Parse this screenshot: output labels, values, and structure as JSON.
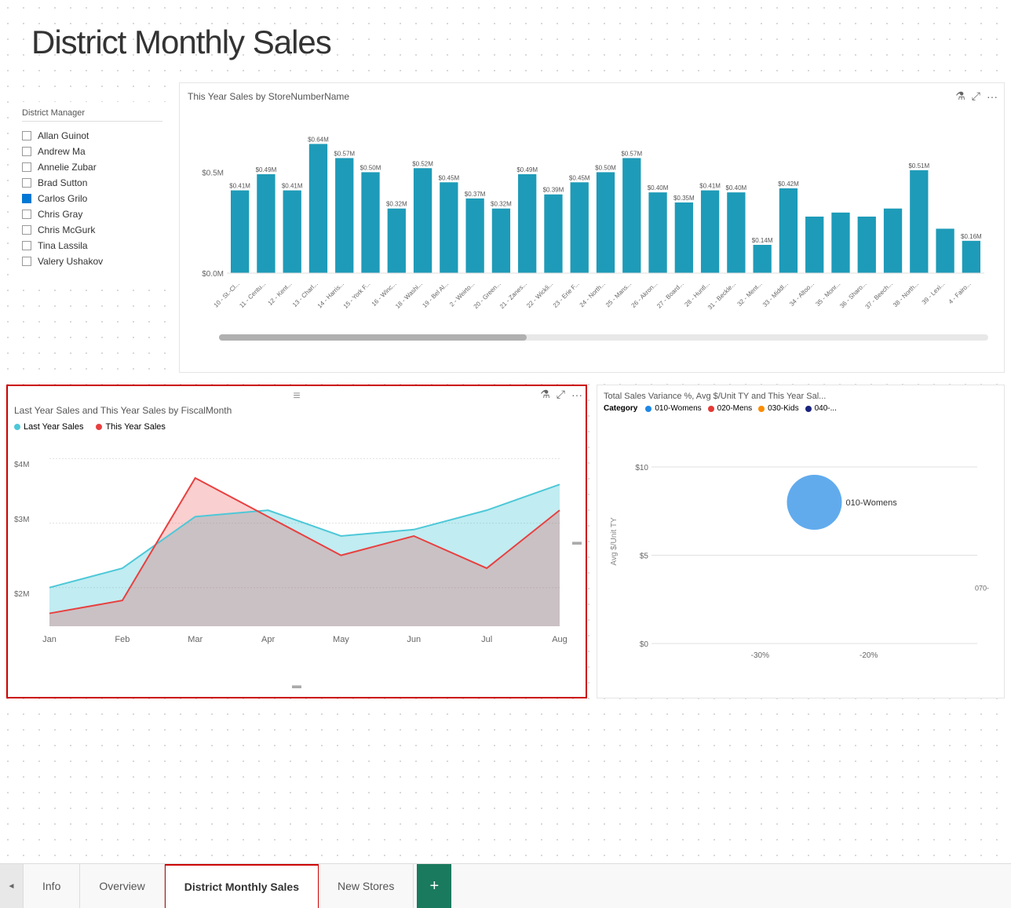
{
  "page": {
    "title": "District Monthly Sales",
    "background": "dotted"
  },
  "district_manager": {
    "label": "District Manager",
    "managers": [
      {
        "name": "Allan Guinot",
        "checked": false
      },
      {
        "name": "Andrew Ma",
        "checked": false
      },
      {
        "name": "Annelie Zubar",
        "checked": false
      },
      {
        "name": "Brad Sutton",
        "checked": false
      },
      {
        "name": "Carlos Grilo",
        "checked": true
      },
      {
        "name": "Chris Gray",
        "checked": false
      },
      {
        "name": "Chris McGurk",
        "checked": false
      },
      {
        "name": "Tina Lassila",
        "checked": false
      },
      {
        "name": "Valery Ushakov",
        "checked": false
      }
    ]
  },
  "bar_chart": {
    "title": "This Year Sales by StoreNumberName",
    "y_min": "$0.0M",
    "y_max": "$0.5M",
    "bars": [
      {
        "label": "10 - St.-Cl...",
        "value": 0.41,
        "display": "$0.41M"
      },
      {
        "label": "11 - Centu...",
        "value": 0.49,
        "display": "$0.49M"
      },
      {
        "label": "12 - Kent...",
        "value": 0.41,
        "display": "$0.41M"
      },
      {
        "label": "13 - Charl...",
        "value": 0.64,
        "display": "$0.64M"
      },
      {
        "label": "14 - Harris...",
        "value": 0.57,
        "display": "$0.57M"
      },
      {
        "label": "15 - York F...",
        "value": 0.5,
        "display": "$0.50M"
      },
      {
        "label": "16 - Winc...",
        "value": 0.32,
        "display": "$0.32M"
      },
      {
        "label": "18 - Washi...",
        "value": 0.52,
        "display": "$0.52M"
      },
      {
        "label": "19 - Bel Al...",
        "value": 0.45,
        "display": "$0.45M"
      },
      {
        "label": "2 - Weirto...",
        "value": 0.37,
        "display": "$0.37M"
      },
      {
        "label": "20 - Green...",
        "value": 0.32,
        "display": "$0.32M"
      },
      {
        "label": "21 - Zanes...",
        "value": 0.49,
        "display": "$0.49M"
      },
      {
        "label": "22 - Wickli...",
        "value": 0.39,
        "display": "$0.39M"
      },
      {
        "label": "23 - Erie F...",
        "value": 0.45,
        "display": "$0.45M"
      },
      {
        "label": "24 - North...",
        "value": 0.5,
        "display": "$0.50M"
      },
      {
        "label": "25 - Mans...",
        "value": 0.57,
        "display": "$0.57M"
      },
      {
        "label": "26 - Akron...",
        "value": 0.4,
        "display": "$0.40M"
      },
      {
        "label": "27 - Board...",
        "value": 0.35,
        "display": "$0.35M"
      },
      {
        "label": "28 - Huntl...",
        "value": 0.41,
        "display": "$0.41M"
      },
      {
        "label": "31 - Beckle...",
        "value": 0.4,
        "display": "$0.40M"
      },
      {
        "label": "32 - Ment...",
        "value": 0.14,
        "display": "$0.14M"
      },
      {
        "label": "33 - Middl...",
        "value": 0.42,
        "display": "$0.42M"
      },
      {
        "label": "34 - Altoo...",
        "value": 0.28,
        "display": ""
      },
      {
        "label": "35 - Monr...",
        "value": 0.3,
        "display": ""
      },
      {
        "label": "36 - Sharo...",
        "value": 0.28,
        "display": ""
      },
      {
        "label": "37 - Beech...",
        "value": 0.32,
        "display": ""
      },
      {
        "label": "38 - North...",
        "value": 0.51,
        "display": "$0.51M"
      },
      {
        "label": "39 - Lexi...",
        "value": 0.22,
        "display": ""
      },
      {
        "label": "4 - Fairo...",
        "value": 0.16,
        "display": "$0.16M"
      }
    ]
  },
  "area_chart": {
    "title": "Last Year Sales and This Year Sales by FiscalMonth",
    "legend": {
      "last_year": "Last Year Sales",
      "this_year": "This Year Sales"
    },
    "y_labels": [
      "$4M",
      "$3M",
      "$2M"
    ],
    "x_labels": [
      "Jan",
      "Feb",
      "Mar",
      "Apr",
      "May",
      "Jun",
      "Jul",
      "Aug"
    ],
    "last_year_color": "#4dc8d8",
    "this_year_color": "#e84040"
  },
  "scatter_chart": {
    "title": "Total Sales Variance %, Avg $/Unit TY and This Year Sal...",
    "category_label": "Category",
    "legend": [
      {
        "label": "010-Womens",
        "color": "#1e88e5"
      },
      {
        "label": "020-Mens",
        "color": "#e53935"
      },
      {
        "label": "030-Kids",
        "color": "#fb8c00"
      },
      {
        "label": "040-...",
        "color": "#1a237e"
      }
    ],
    "y_label": "Avg $/Unit TY",
    "y_ticks": [
      "$10",
      "$5",
      "$0"
    ],
    "x_ticks": [
      "-30%",
      "-20%"
    ],
    "bubble": {
      "label": "010-Womens",
      "x": -25,
      "y": 8,
      "size": 40,
      "color": "#1e88e5"
    }
  },
  "tabs": {
    "nav_prev": "◄",
    "nav_next": "►",
    "items": [
      {
        "label": "Info",
        "active": false
      },
      {
        "label": "Overview",
        "active": false
      },
      {
        "label": "District Monthly Sales",
        "active": true
      },
      {
        "label": "New Stores",
        "active": false
      }
    ],
    "add_label": "+"
  }
}
